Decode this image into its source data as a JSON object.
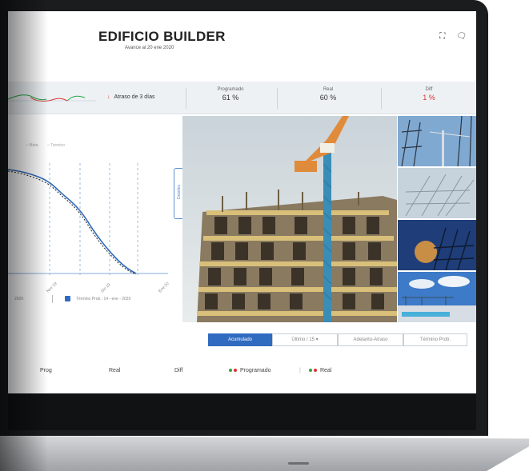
{
  "header": {
    "title": "EDIFICIO BUILDER",
    "subtitle": "Avance al 20 ene 2020"
  },
  "kpis": {
    "status": "Atraso de 3 días",
    "programado": {
      "label": "Programado",
      "value": "61 %"
    },
    "real": {
      "label": "Real",
      "value": "60 %"
    },
    "diff": {
      "label": "Diff",
      "value": "1 %"
    }
  },
  "chart": {
    "legend": [
      "Meta",
      "Termino"
    ],
    "detalles_label": "Detalles",
    "x_ticks": [
      "Nov 19",
      "Dic 19",
      "Ene 20"
    ],
    "date_label": "Término Prob.: 14 - ene - 2020",
    "date_left": "2020"
  },
  "toolbar": {
    "buttons": [
      {
        "label": "Acumulado",
        "active": true
      },
      {
        "label": "Último / 15 ▾",
        "active": false
      },
      {
        "label": "Adelanto-Atraso",
        "active": false
      },
      {
        "label": "Término Prob.",
        "active": false
      }
    ]
  },
  "footer": {
    "prog": "Prog",
    "real": "Real",
    "diff": "Diff",
    "legend_programado": "Programado",
    "legend_real": "Real"
  },
  "colors": {
    "accent": "#2f6bbf",
    "negative": "#e03030",
    "positive": "#27a745"
  },
  "icons": [
    "expand-icon",
    "chat-icon",
    "calendar-icon",
    "arrow-down-icon"
  ]
}
